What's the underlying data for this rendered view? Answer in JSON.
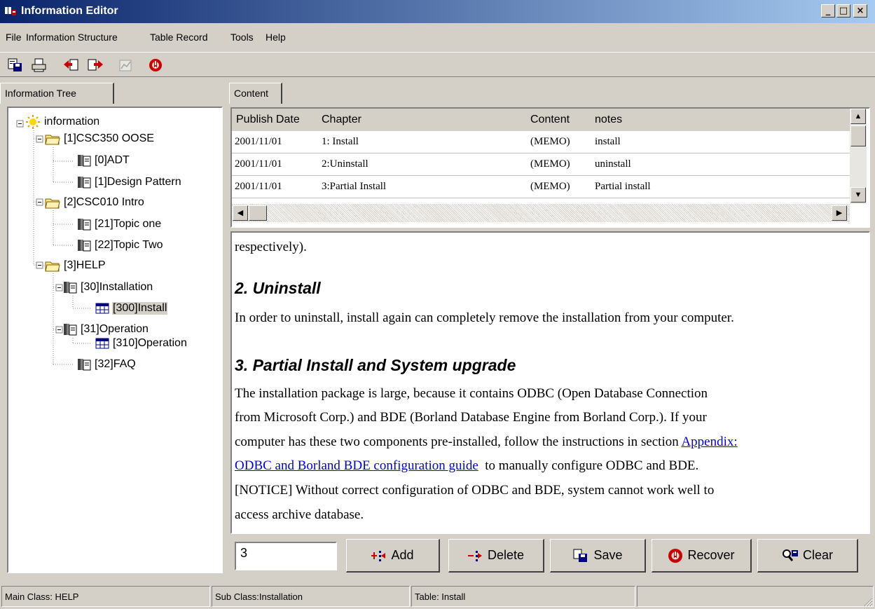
{
  "window": {
    "title": "Information Editor",
    "buttons": {
      "minimize": "_",
      "maximize": "□",
      "close": "×"
    }
  },
  "menu": [
    "File",
    "Information Structure",
    "Table Record",
    "Tools",
    "Help"
  ],
  "toolbar": {
    "icons": [
      "save-to-file-icon",
      "print-icon",
      "import-icon",
      "export-icon",
      "report-icon",
      "recover-icon"
    ]
  },
  "left_tab": "Information Tree",
  "right_tab": "Content",
  "tree": [
    {
      "label": "information",
      "icon": "sun-icon"
    },
    {
      "label": "[1]CSC350 OOSE",
      "icon": "folder-icon"
    },
    {
      "label": "[0]ADT",
      "icon": "book-icon"
    },
    {
      "label": "[1]Design Pattern",
      "icon": "book-icon"
    },
    {
      "label": "[2]CSC010 Intro",
      "icon": "folder-icon"
    },
    {
      "label": "[21]Topic one",
      "icon": "book-icon"
    },
    {
      "label": "[22]Topic Two",
      "icon": "book-icon"
    },
    {
      "label": "[3]HELP",
      "icon": "folder-icon"
    },
    {
      "label": "[30]Installation",
      "icon": "book-icon"
    },
    {
      "label": "[300]Install",
      "icon": "table-icon"
    },
    {
      "label": "[31]Operation",
      "icon": "book-icon"
    },
    {
      "label": "[310]Operation",
      "icon": "table-icon"
    },
    {
      "label": "[32]FAQ",
      "icon": "book-icon"
    }
  ],
  "grid": {
    "columns": [
      "Publish Date",
      "Chapter",
      "Content",
      "notes"
    ],
    "rows": [
      [
        "2001/11/01",
        "1: Install",
        "(MEMO)",
        "install"
      ],
      [
        "2001/11/01",
        "2:Uninstall",
        "(MEMO)",
        "uninstall"
      ],
      [
        "2001/11/01",
        "3:Partial Install",
        "(MEMO)",
        "Partial install"
      ]
    ]
  },
  "content": {
    "line0": "respectively).",
    "heading2": "2. Uninstall",
    "para2": "In order to uninstall, install again can completely remove the installation from your computer.",
    "heading3": "3. Partial Install and System upgrade",
    "p3_line1": "The installation package is large, because it contains ODBC (Open Database Connection",
    "p3_line2": "from Microsoft Corp.) and BDE (Borland Database Engine from Borland Corp.). If your",
    "p3_line3_pre": "computer has these two components pre-installed, follow the instructions in section ",
    "p3_link_a": "Appendix:",
    "p3_link_b": "ODBC and Borland BDE configuration guide",
    "p3_line4_post": "  to manually configure ODBC and BDE.",
    "p3_line5": "[NOTICE] Without correct configuration of ODBC and BDE, system cannot work well to",
    "p3_line6": "access archive database."
  },
  "record_number": "3",
  "buttons": {
    "add": "Add",
    "delete": "Delete",
    "save": "Save",
    "recover": "Recover",
    "clear": "Clear"
  },
  "status": {
    "main_class": "Main Class: HELP",
    "sub_class": "Sub Class:Installation",
    "table": "Table: Install",
    "extra": ""
  }
}
